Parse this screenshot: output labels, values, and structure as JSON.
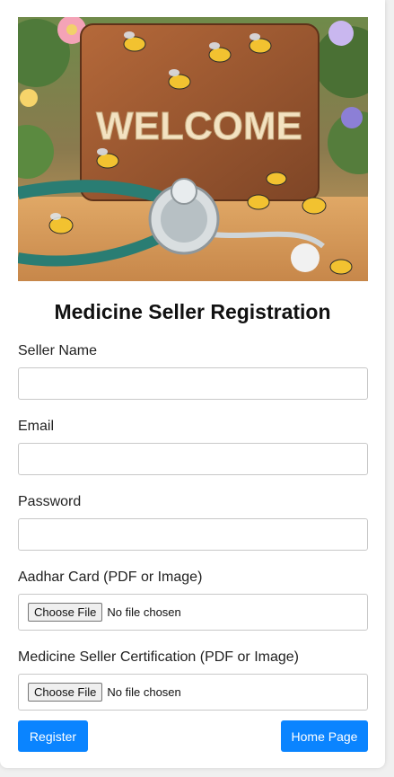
{
  "hero": {
    "sign_text": "WELCOME"
  },
  "form": {
    "title": "Medicine Seller Registration",
    "fields": [
      {
        "label": "Seller Name",
        "value": "",
        "placeholder": ""
      },
      {
        "label": "Email",
        "value": "",
        "placeholder": ""
      },
      {
        "label": "Password",
        "value": "",
        "placeholder": ""
      }
    ],
    "files": [
      {
        "label": "Aadhar Card (PDF or Image)",
        "button": "Choose File",
        "status": "No file chosen"
      },
      {
        "label": "Medicine Seller Certification (PDF or Image)",
        "button": "Choose File",
        "status": "No file chosen"
      }
    ]
  },
  "buttons": {
    "register": "Register",
    "home": "Home Page"
  },
  "colors": {
    "accent": "#0a84ff",
    "background": "#f0f0f0",
    "card": "#ffffff"
  }
}
